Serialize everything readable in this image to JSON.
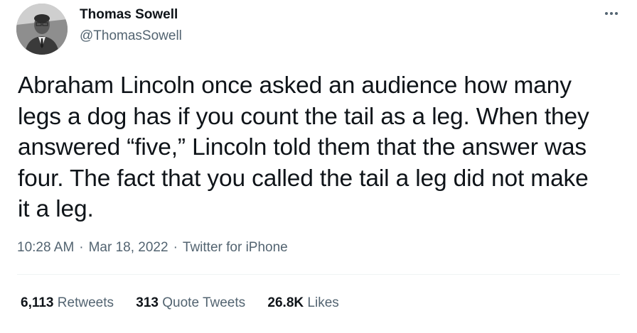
{
  "author": {
    "name": "Thomas Sowell",
    "handle": "@ThomasSowell",
    "avatar_icon": "profile-photo-grayscale"
  },
  "more_icon": "three-dots-horizontal",
  "tweet": {
    "text": "Abraham Lincoln once asked an audience how many\nlegs a dog has if you count the tail as a leg. When they\nanswered “five,” Lincoln told them that the answer was\nfour. The fact that you called the tail a leg did not make\nit a leg."
  },
  "meta": {
    "time": "10:28 AM",
    "separator": "·",
    "date": "Mar 18, 2022",
    "source": "Twitter for iPhone"
  },
  "stats": {
    "retweets": {
      "count": "6,113",
      "label": "Retweets"
    },
    "quote_tweets": {
      "count": "313",
      "label": "Quote Tweets"
    },
    "likes": {
      "count": "26.8K",
      "label": "Likes"
    }
  },
  "colors": {
    "text_primary": "#0f1419",
    "text_secondary": "#536471",
    "divider": "#eff3f4",
    "background": "#ffffff"
  }
}
